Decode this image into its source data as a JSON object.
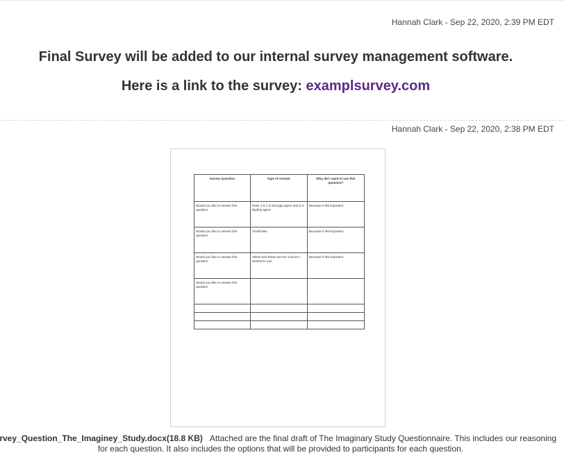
{
  "post1": {
    "meta": "Hannah Clark - Sep 22, 2020, 2:39 PM EDT",
    "heading": "Final Survey will be added to our internal survey management software.",
    "link_prefix": "Here is a link to the survey: ",
    "link_text": "examplsurvey.com"
  },
  "post2": {
    "meta": "Hannah Clark - Sep 22, 2020, 2:38 PM EDT",
    "attachment": {
      "filename": "Survey_Question_The_Imaginey_Study.docx",
      "size": "(18.8 KB)",
      "description_line1": "Attached are the final draft of The Imaginary Study Questionnaire. This includes our reasoning",
      "description_line2": "for each question. It also includes the options that will be provided to participants for each question."
    },
    "document_table": {
      "headers": [
        "Survey Question",
        "Type of Answer",
        "Why did I want to use this question?"
      ],
      "rows": [
        [
          "Would you like to answer this question",
          "Rank 1-5 1 is strongly agree and 5 is slightly agree",
          "Because it felt important"
        ],
        [
          "Would you like to answer this question",
          "True/False",
          "Because it felt important"
        ],
        [
          "Would you like to answer this question",
          "ABCD and these are the choices I wanted to use",
          "Because it felt important"
        ],
        [
          "Would you like to answer this question",
          "",
          ""
        ]
      ],
      "empty_rows": 3
    }
  },
  "colors": {
    "link": "#5b2a86",
    "text": "#333333"
  }
}
